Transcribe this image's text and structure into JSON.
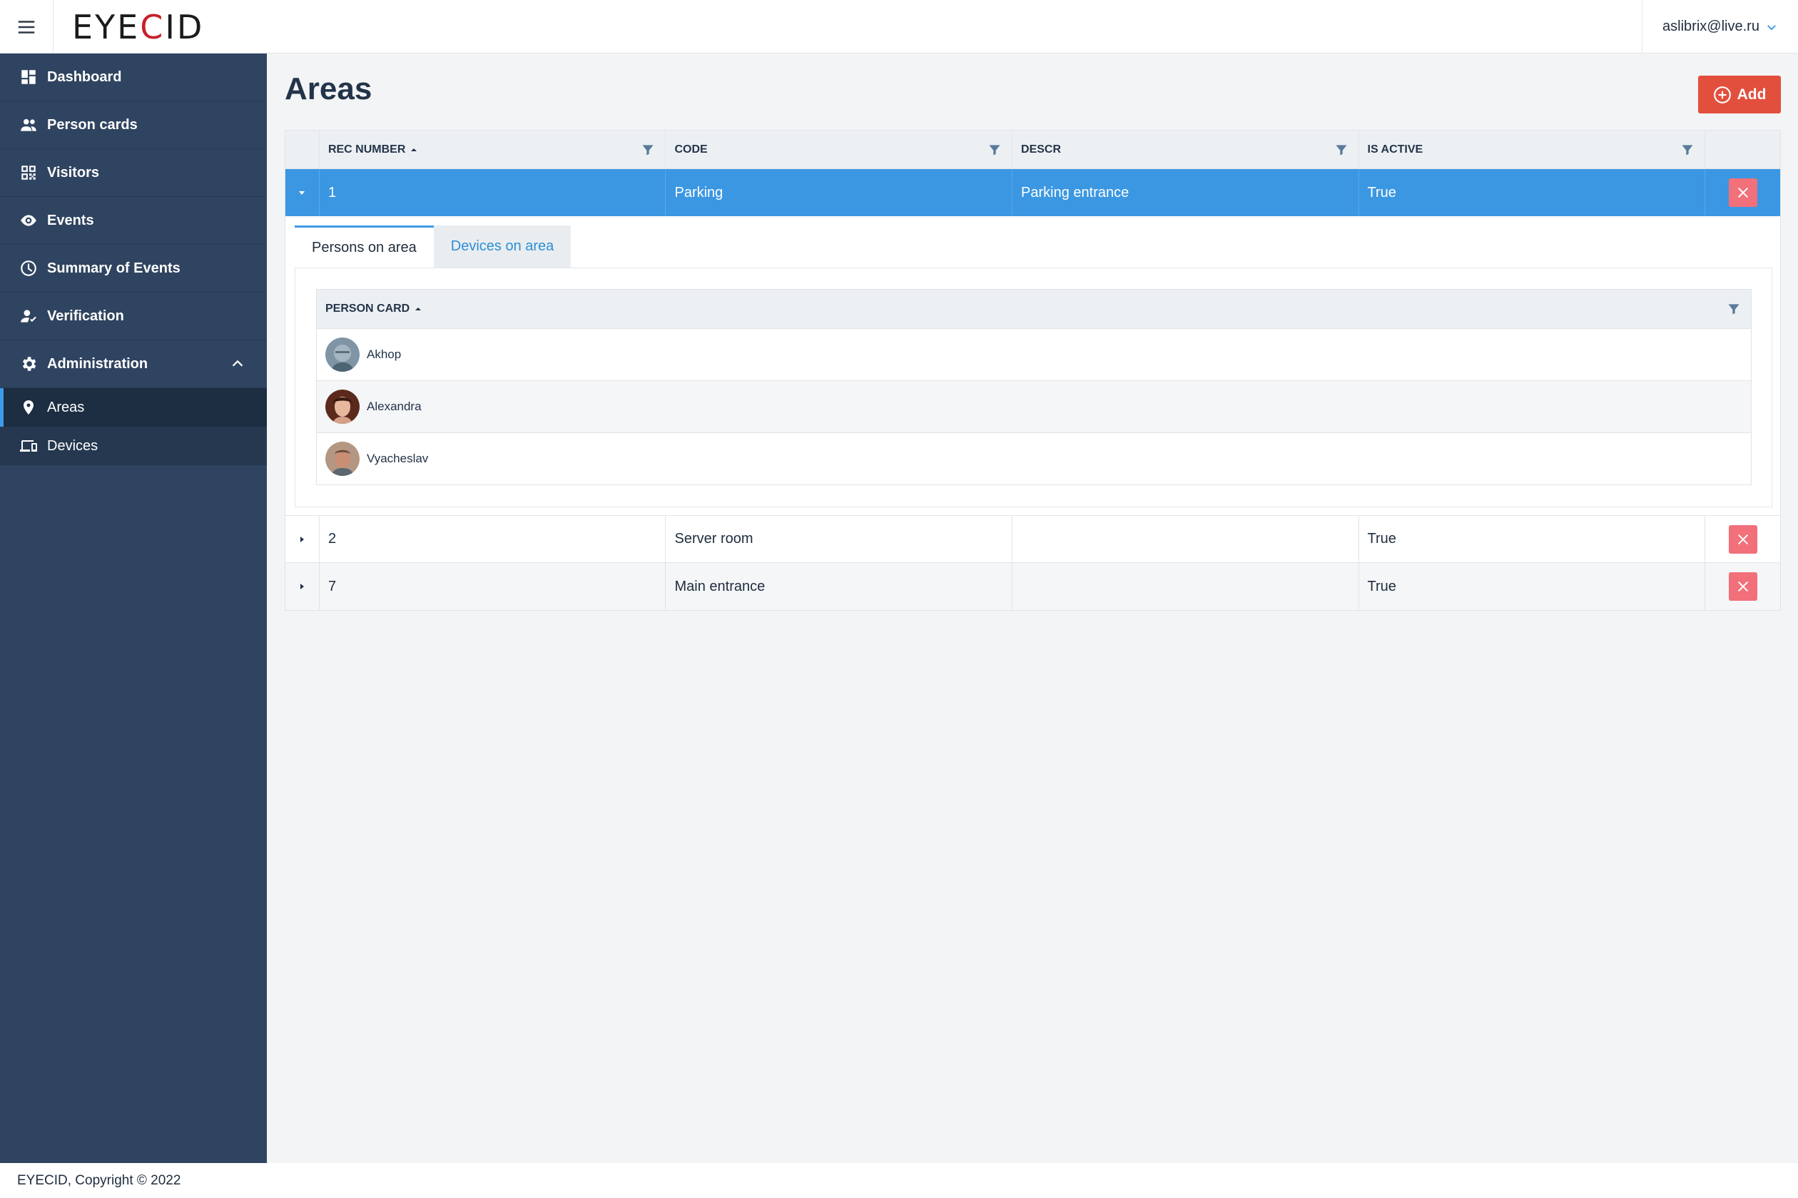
{
  "header": {
    "logo_pre": "EYE",
    "logo_c": "C",
    "logo_post": "ID",
    "user_email": "aslibrix@live.ru"
  },
  "sidebar": {
    "items": [
      {
        "label": "Dashboard",
        "icon": "dashboard-icon"
      },
      {
        "label": "Person cards",
        "icon": "people-icon"
      },
      {
        "label": "Visitors",
        "icon": "qr-code-icon"
      },
      {
        "label": "Events",
        "icon": "eye-icon"
      },
      {
        "label": "Summary of Events",
        "icon": "clock-icon"
      },
      {
        "label": "Verification",
        "icon": "person-check-icon"
      },
      {
        "label": "Administration",
        "icon": "gear-icon"
      }
    ],
    "sub_items": [
      {
        "label": "Areas",
        "icon": "location-pin-icon"
      },
      {
        "label": "Devices",
        "icon": "devices-icon"
      }
    ]
  },
  "page": {
    "title": "Areas",
    "add_label": "Add"
  },
  "grid": {
    "columns": [
      "REC NUMBER",
      "CODE",
      "DESCR",
      "IS ACTIVE"
    ],
    "rows": [
      {
        "rec": "1",
        "code": "Parking",
        "descr": "Parking entrance",
        "active": "True"
      },
      {
        "rec": "2",
        "code": "Server room",
        "descr": "",
        "active": "True"
      },
      {
        "rec": "7",
        "code": "Main entrance",
        "descr": "",
        "active": "True"
      }
    ]
  },
  "detail": {
    "tabs": [
      "Persons on area",
      "Devices on area"
    ],
    "column": "PERSON CARD",
    "persons": [
      "Akhop",
      "Alexandra",
      "Vyacheslav"
    ]
  },
  "footer": {
    "text": "EYECID, Copyright © 2022"
  },
  "colors": {
    "sidebar_bg": "#2f4460",
    "selected_row": "#3b97e2",
    "add_button": "#e24f3c",
    "delete_button": "#f2707a",
    "accent": "#3d9be9"
  }
}
